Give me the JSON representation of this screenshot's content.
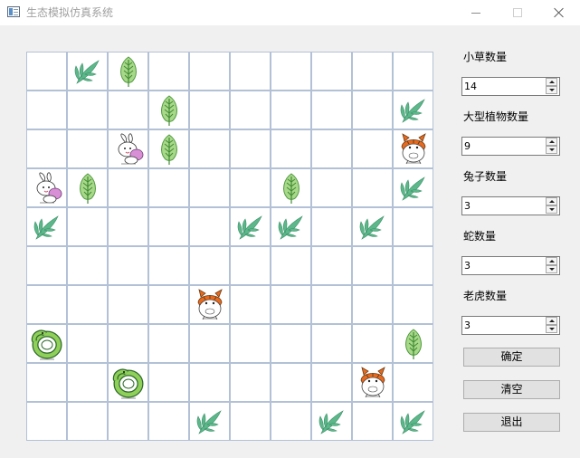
{
  "window": {
    "title": "生态模拟仿真系统"
  },
  "grid": {
    "rows": 10,
    "cols": 10,
    "cells": [
      [
        "",
        "grass",
        "plant",
        "",
        "",
        "",
        "",
        "",
        "",
        ""
      ],
      [
        "",
        "",
        "",
        "plant",
        "",
        "",
        "",
        "",
        "",
        "grass"
      ],
      [
        "",
        "",
        "rabbit",
        "plant",
        "",
        "",
        "",
        "",
        "",
        "tiger"
      ],
      [
        "rabbit",
        "plant",
        "",
        "",
        "",
        "",
        "plant",
        "",
        "",
        "grass"
      ],
      [
        "grass",
        "",
        "",
        "",
        "",
        "grass",
        "grass",
        "",
        "grass",
        ""
      ],
      [
        "",
        "",
        "",
        "",
        "",
        "",
        "",
        "",
        "",
        ""
      ],
      [
        "",
        "",
        "",
        "",
        "tiger",
        "",
        "",
        "",
        "",
        ""
      ],
      [
        "snake",
        "",
        "",
        "",
        "",
        "",
        "",
        "",
        "",
        "plant"
      ],
      [
        "",
        "",
        "snake",
        "",
        "",
        "",
        "",
        "",
        "tiger",
        ""
      ],
      [
        "",
        "",
        "",
        "",
        "grass",
        "",
        "",
        "grass",
        "",
        "grass"
      ]
    ]
  },
  "controls": {
    "grass_label": "小草数量",
    "grass_value": "14",
    "plant_label": "大型植物数量",
    "plant_value": "9",
    "rabbit_label": "兔子数量",
    "rabbit_value": "3",
    "snake_label": "蛇数量",
    "snake_value": "3",
    "tiger_label": "老虎数量",
    "tiger_value": "3",
    "confirm_label": "确定",
    "clear_label": "清空",
    "exit_label": "退出"
  }
}
